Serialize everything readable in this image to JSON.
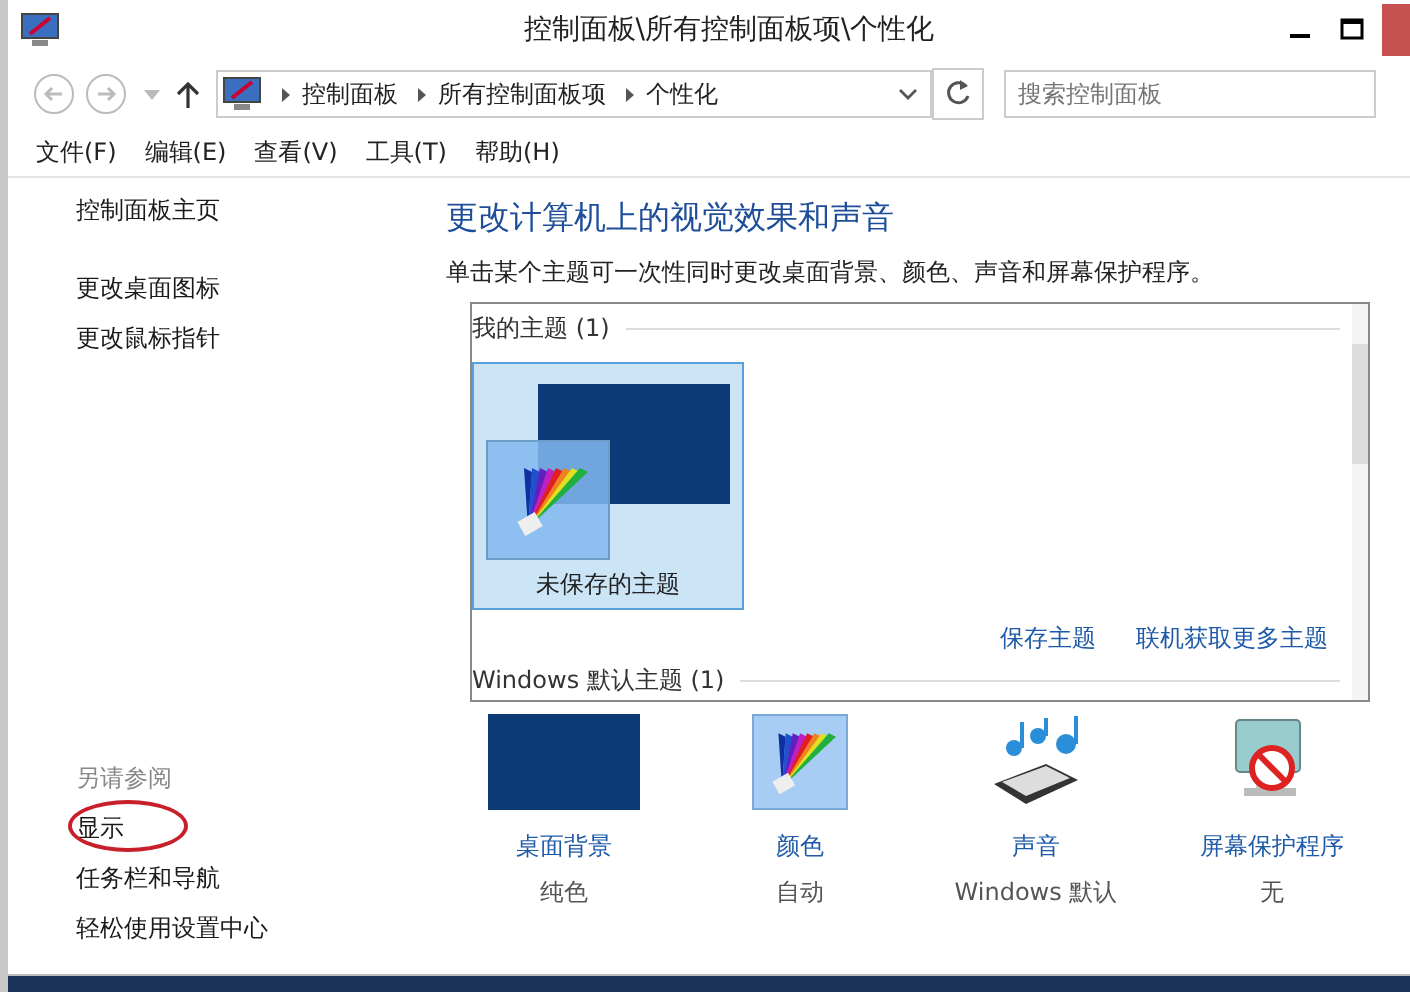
{
  "window": {
    "title": "控制面板\\所有控制面板项\\个性化"
  },
  "address_bar": {
    "crumbs": [
      "控制面板",
      "所有控制面板项",
      "个性化"
    ]
  },
  "search": {
    "placeholder": "搜索控制面板"
  },
  "menu": [
    "文件(F)",
    "编辑(E)",
    "查看(V)",
    "工具(T)",
    "帮助(H)"
  ],
  "sidebar": {
    "links": [
      "控制面板主页",
      "更改桌面图标",
      "更改鼠标指针"
    ],
    "see_also": {
      "heading": "另请参阅",
      "links": [
        {
          "label": "显示",
          "circled": true
        },
        {
          "label": "任务栏和导航",
          "circled": false
        },
        {
          "label": "轻松使用设置中心",
          "circled": false
        }
      ]
    }
  },
  "main": {
    "heading": "更改计算机上的视觉效果和声音",
    "description": "单击某个主题可一次性同时更改桌面背景、颜色、声音和屏幕保护程序。",
    "theme_groups": [
      {
        "title": "我的主题 (1)",
        "themes": [
          {
            "name": "未保存的主题",
            "selected": true
          }
        ]
      },
      {
        "title": "Windows 默认主题 (1)"
      }
    ],
    "theme_links": [
      "保存主题",
      "联机获取更多主题"
    ],
    "settings": [
      {
        "kind": "background",
        "label": "桌面背景",
        "value": "纯色"
      },
      {
        "kind": "color",
        "label": "颜色",
        "value": "自动"
      },
      {
        "kind": "sound",
        "label": "声音",
        "value": "Windows 默认"
      },
      {
        "kind": "screensaver",
        "label": "屏幕保护程序",
        "value": "无"
      }
    ]
  }
}
